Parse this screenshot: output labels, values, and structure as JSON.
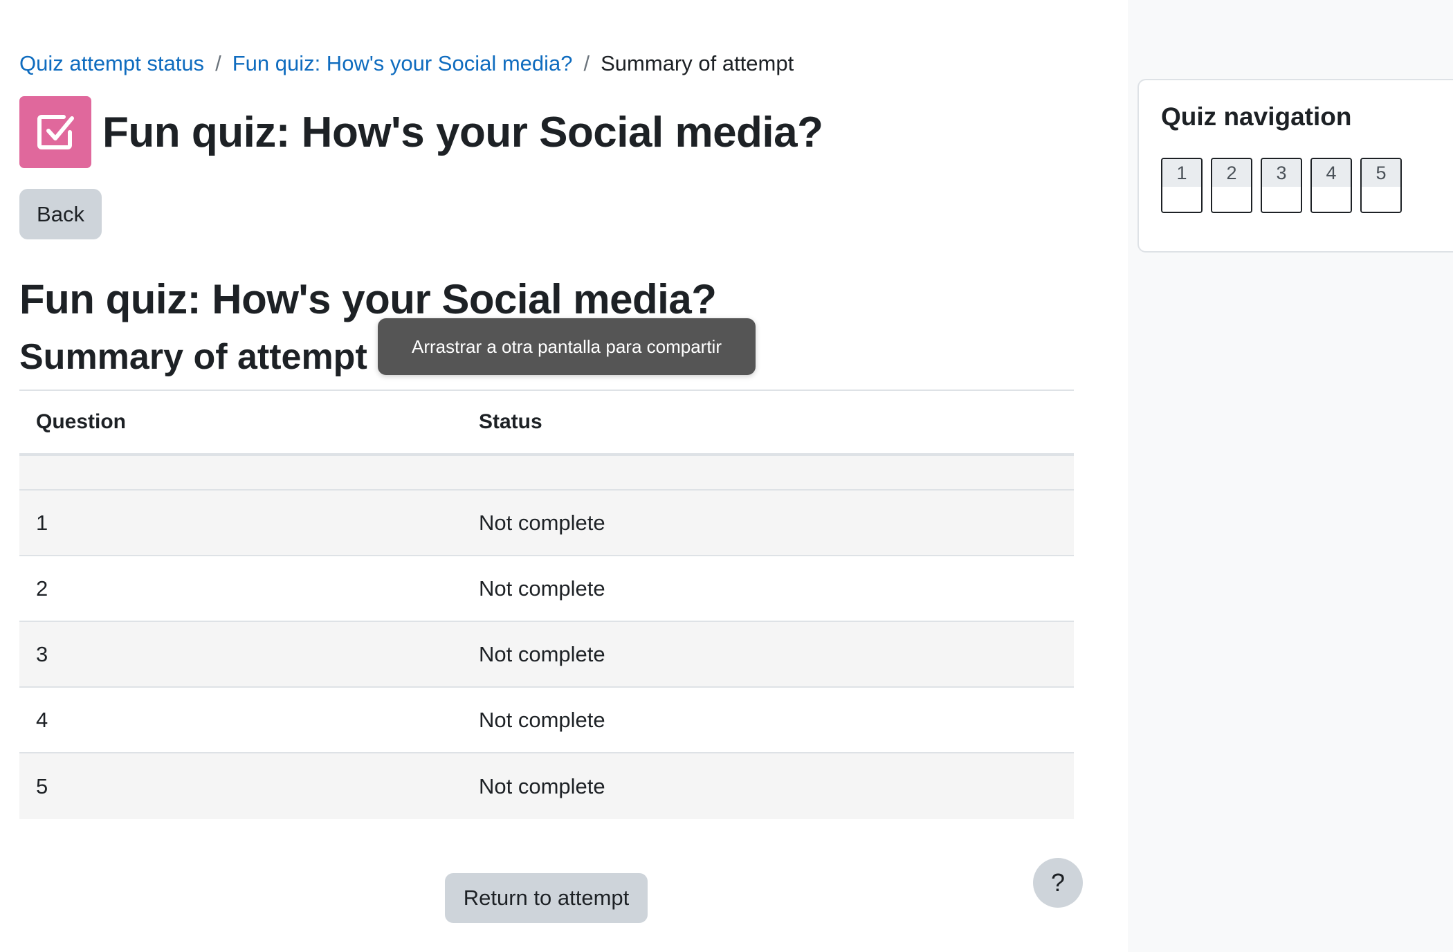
{
  "breadcrumb": {
    "items": [
      {
        "label": "Quiz attempt status"
      },
      {
        "label": "Fun quiz: How's your Social media?"
      },
      {
        "label": "Summary of attempt"
      }
    ],
    "separator": "/"
  },
  "header": {
    "title": "Fun quiz: How's your Social media?",
    "icon": "quiz-checkbox-icon",
    "icon_color": "#e0689c"
  },
  "back_button": {
    "label": "Back"
  },
  "content": {
    "heading": "Fun quiz: How's your Social media?",
    "subheading": "Summary of attempt"
  },
  "tooltip": {
    "text": "Arrastrar a otra pantalla para compartir"
  },
  "summary_table": {
    "columns": [
      "Question",
      "Status"
    ],
    "rows": [
      {
        "question": "1",
        "status": "Not complete"
      },
      {
        "question": "2",
        "status": "Not complete"
      },
      {
        "question": "3",
        "status": "Not complete"
      },
      {
        "question": "4",
        "status": "Not complete"
      },
      {
        "question": "5",
        "status": "Not complete"
      }
    ]
  },
  "return_button": {
    "label": "Return to attempt"
  },
  "help_button": {
    "label": "?"
  },
  "quiz_navigation": {
    "title": "Quiz navigation",
    "questions": [
      "1",
      "2",
      "3",
      "4",
      "5"
    ]
  },
  "colors": {
    "link": "#0f6cbf",
    "button_bg": "#ced4da",
    "drawer_bg": "#f8f9fa"
  }
}
